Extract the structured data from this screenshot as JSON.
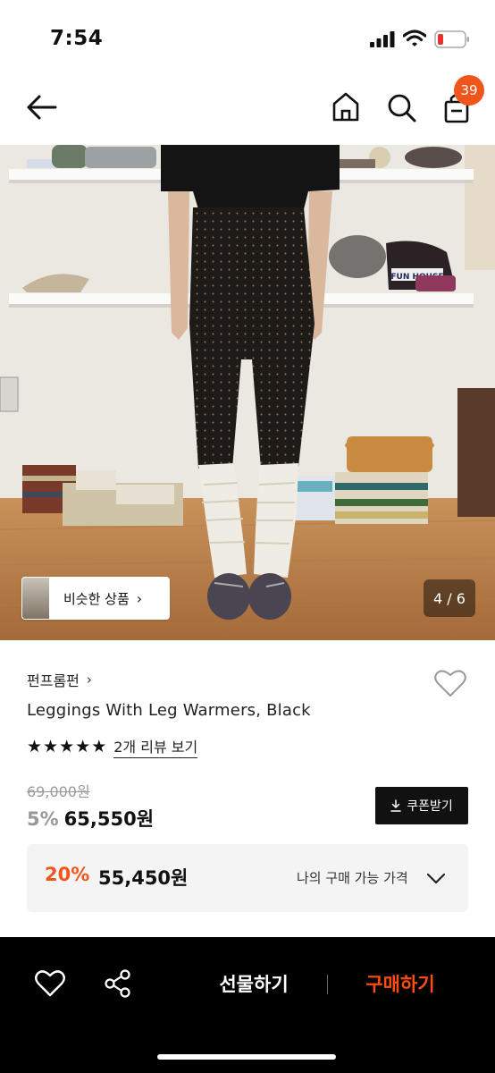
{
  "status_bar": {
    "time": "7:54"
  },
  "header": {
    "cart_count": "39"
  },
  "gallery": {
    "similar_label": "비슷한 상품",
    "similar_chevron": "›",
    "page_counter": "4 / 6",
    "photo_text": "FUN HOUSE"
  },
  "product": {
    "brand": "펀프롬펀",
    "brand_chevron": "›",
    "name": "Leggings With Leg Warmers, Black",
    "rating_stars": 5,
    "review_link": "2개 리뷰 보기",
    "original_price": "69,000원",
    "discount_pct": "5%",
    "sale_price": "65,550원",
    "coupon_label": "쿠폰받기"
  },
  "member_price": {
    "pct": "20%",
    "price": "55,450원",
    "label": "나의 구매 가능 가격"
  },
  "bottom_bar": {
    "gift_label": "선물하기",
    "buy_label": "구매하기"
  },
  "colors": {
    "accent": "#f0551c",
    "buy": "#ff4d12",
    "bar": "#000000"
  }
}
